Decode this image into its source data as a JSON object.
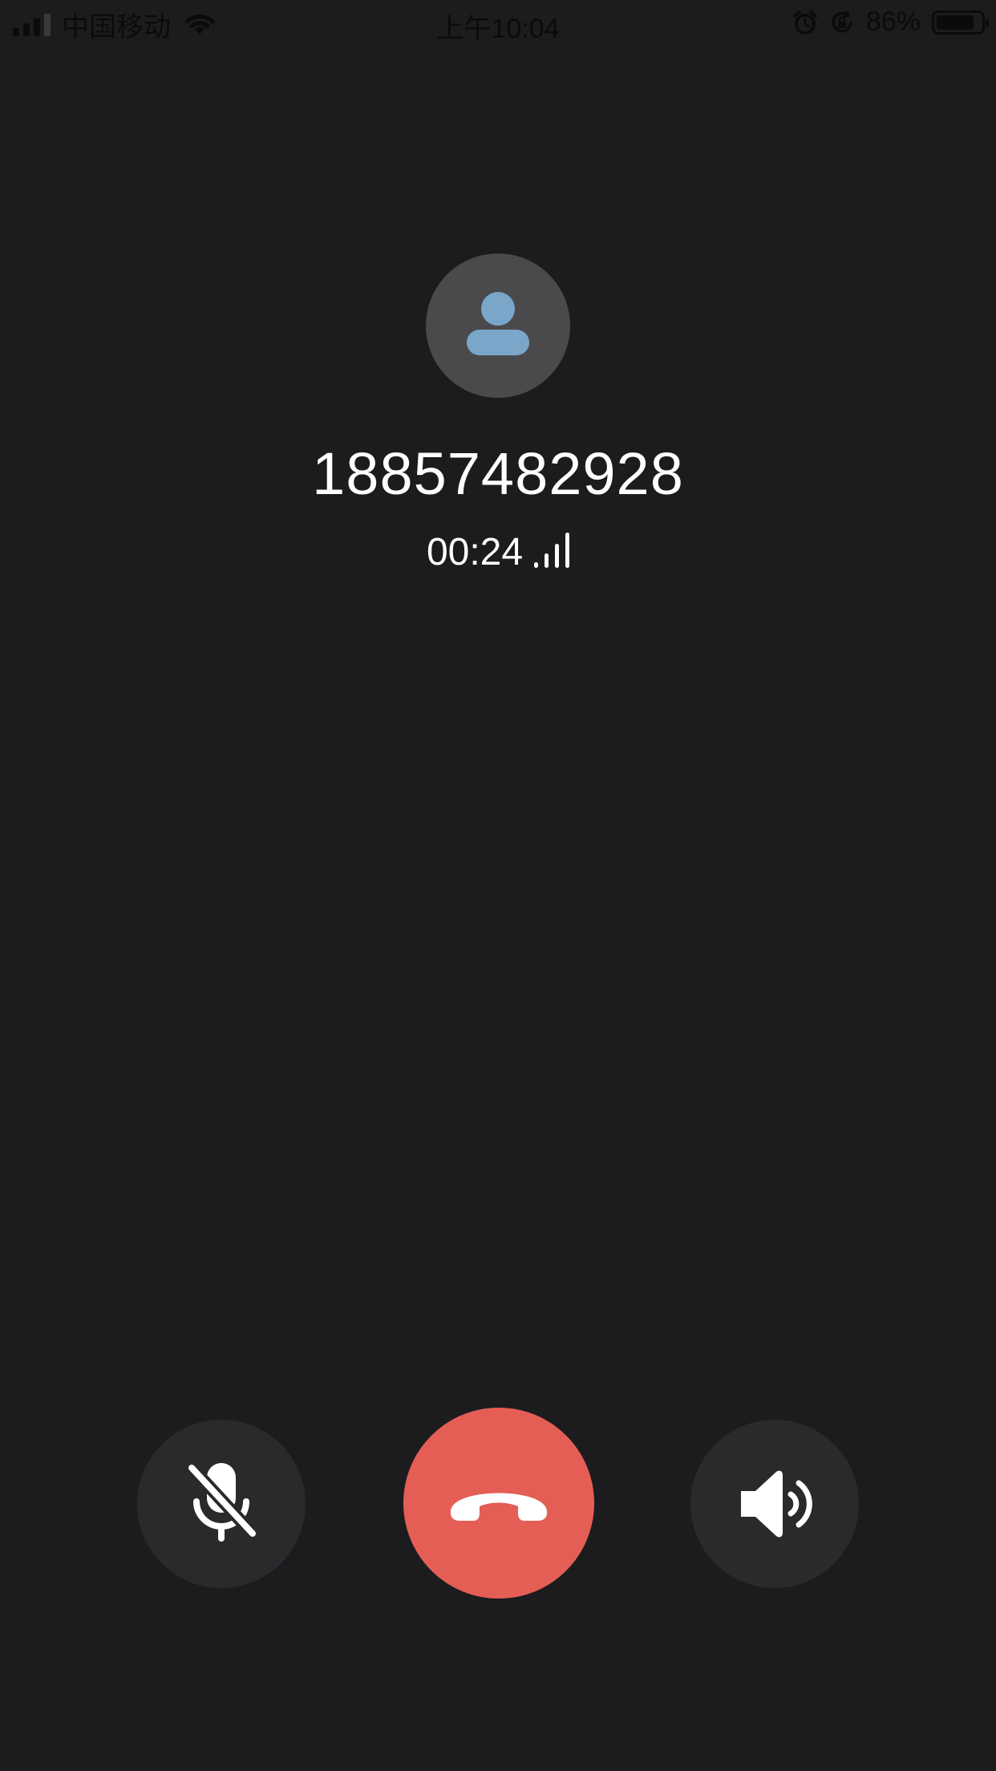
{
  "status_bar": {
    "carrier": "中国移动",
    "time": "上午10:04",
    "battery_percent": "86%",
    "battery_level": 0.86,
    "icons": [
      "cellular-signal-icon",
      "wifi-icon",
      "alarm-icon",
      "rotation-lock-icon",
      "battery-icon"
    ]
  },
  "call": {
    "phone_number": "18857482928",
    "duration": "00:24",
    "signal_quality_icon": "call-quality-bars-icon",
    "avatar_icon": "person-placeholder-icon"
  },
  "controls": {
    "mute_icon": "microphone-muted-icon",
    "hangup_icon": "hang-up-phone-icon",
    "speaker_icon": "speaker-icon"
  },
  "colors": {
    "background": "#1c1c1f",
    "hangup": "#e55e55",
    "control_bg": "#2a2a2d",
    "avatar_bg": "#4a4a4d",
    "avatar_figure": "#7aa6c9"
  }
}
